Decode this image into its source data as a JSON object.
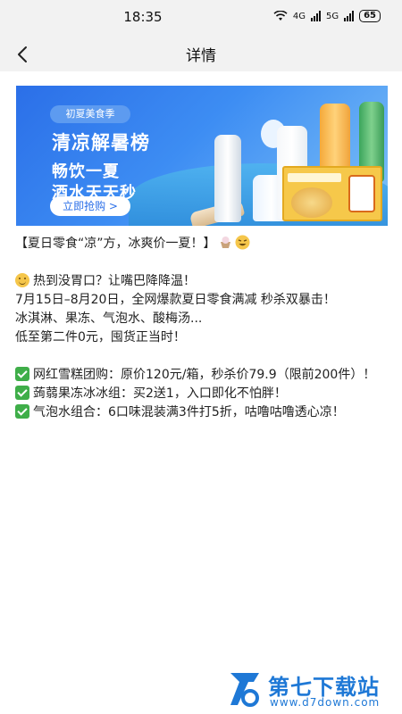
{
  "status_bar": {
    "time": "18:35",
    "wifi_icon": "wifi-icon",
    "network_1": "4G",
    "network_2": "5G",
    "battery": "65"
  },
  "nav": {
    "back_icon": "chevron-left-icon",
    "title": "详情"
  },
  "banner": {
    "badge": "初夏美食季",
    "title": "清凉解暑榜",
    "subtitle_1": "畅饮一夏",
    "subtitle_2": "酒水天天秒",
    "button": "立即抢购 >"
  },
  "article": {
    "headline": "【夏日零食“凉”方，冰爽价一夏！】",
    "intro": "热到没胃口？让嘴巴降降温！",
    "para_1": "7月15日–8月20日，全网爆款夏日零食满减 秒杀双暴击！",
    "para_2": "冰淇淋、果冻、气泡水、酸梅汤...",
    "para_3": "低至第二件0元，囤货正当时！",
    "items": [
      "网红雪糕团购：原价120元/箱，秒杀价79.9（限前200件）！",
      "蒟蒻果冻冰冰组：买2送1，入口即化不怕胖！",
      "气泡水组合：6口味混装满3件打5折，咕噜咕噜透心凉！"
    ]
  },
  "watermark": {
    "brand": "第七下载站",
    "url": "www.d7down.com"
  },
  "colors": {
    "accent": "#2b6fe8",
    "check": "#3fae49",
    "watermark": "#1e78d6"
  }
}
